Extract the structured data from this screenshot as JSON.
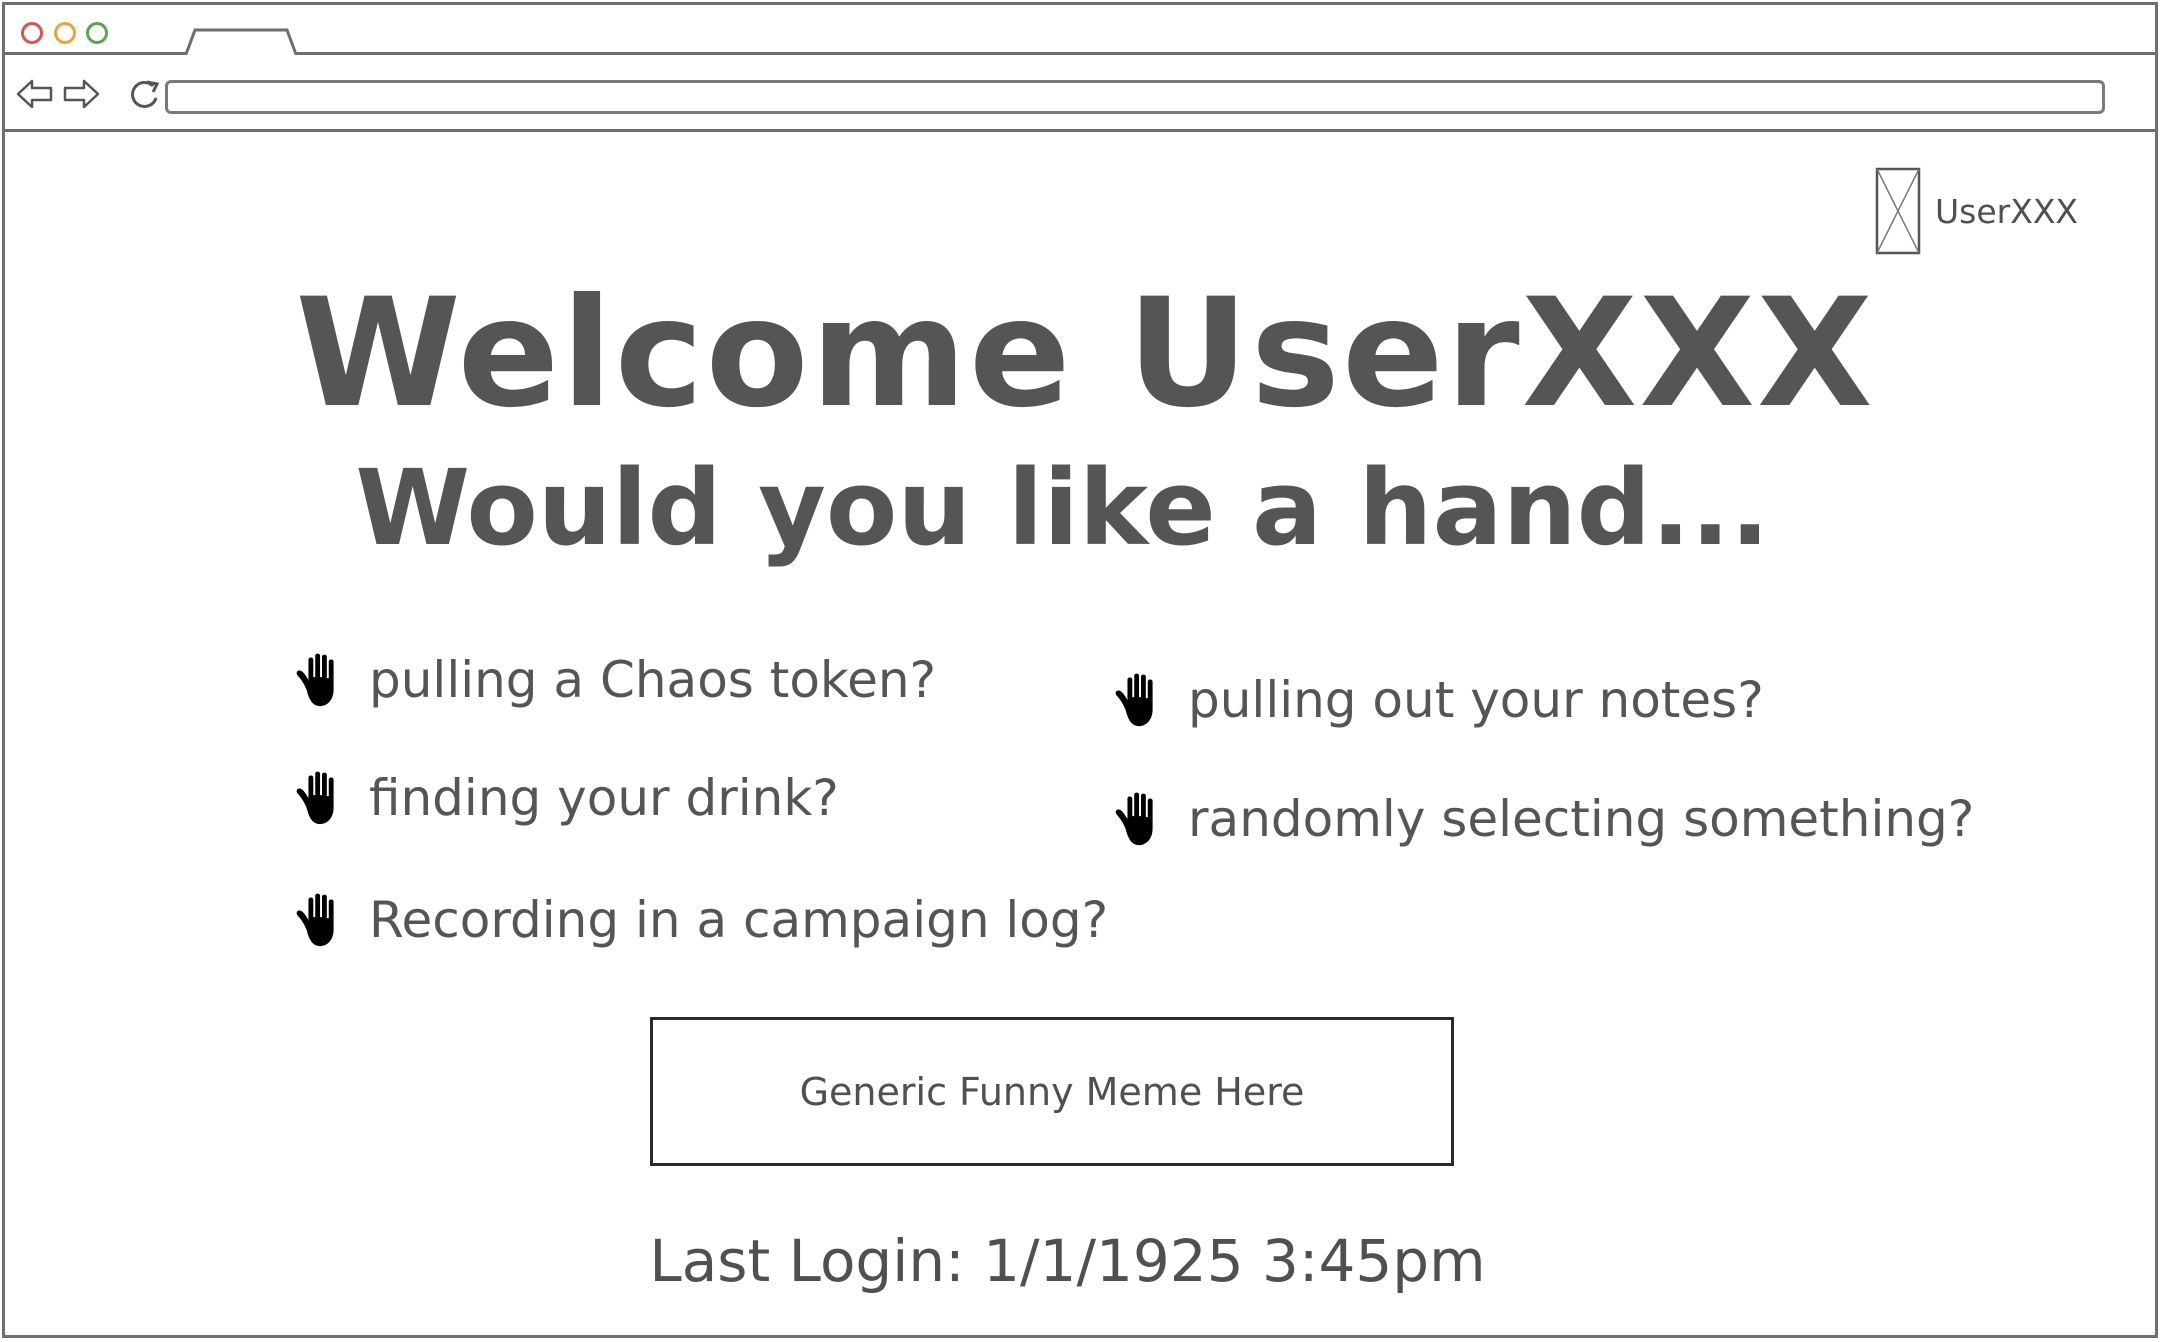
{
  "browser": {
    "window_controls": [
      "close",
      "minimize",
      "maximize"
    ],
    "address": ""
  },
  "header": {
    "username": "UserXXX",
    "avatar_icon": "image-placeholder-icon"
  },
  "main": {
    "welcome": "Welcome UserXXX",
    "subtitle": "Would you like a hand...",
    "options": [
      {
        "label": "pulling a Chaos token?",
        "icon": "hand-icon"
      },
      {
        "label": "finding your drink?",
        "icon": "hand-icon"
      },
      {
        "label": "Recording in a campaign log?",
        "icon": "hand-icon"
      },
      {
        "label": "pulling out your notes?",
        "icon": "hand-icon"
      },
      {
        "label": "randomly selecting something?",
        "icon": "hand-icon"
      }
    ],
    "meme_placeholder": "Generic Funny Meme Here",
    "last_login": "Last Login: 1/1/1925 3:45pm"
  },
  "colors": {
    "text": "#505050",
    "frame": "#6e6e6e",
    "close_dot": "#d9534f",
    "minimize_dot": "#e8a33c",
    "maximize_dot": "#53a653",
    "hand": "#000000"
  }
}
